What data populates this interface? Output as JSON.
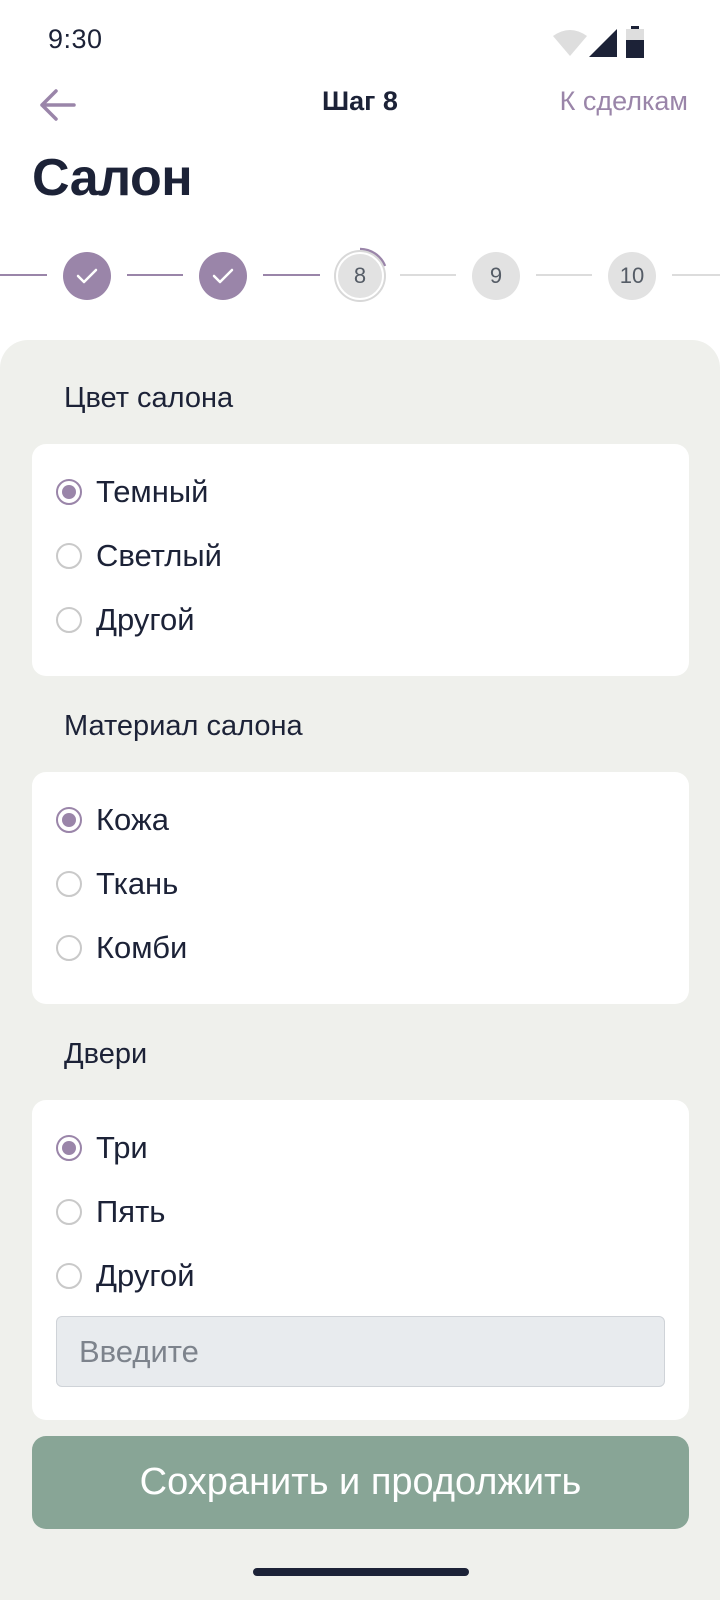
{
  "status_bar": {
    "time": "9:30"
  },
  "header": {
    "step_title": "Шаг 8",
    "to_deals_label": "К сделкам"
  },
  "page_title": "Салон",
  "stepper": {
    "steps": [
      {
        "label": "",
        "state": "done"
      },
      {
        "label": "",
        "state": "done"
      },
      {
        "label": "8",
        "state": "current"
      },
      {
        "label": "9",
        "state": "todo"
      },
      {
        "label": "10",
        "state": "todo"
      }
    ]
  },
  "sections": [
    {
      "title": "Цвет салона",
      "options": [
        {
          "label": "Темный",
          "selected": true
        },
        {
          "label": "Светлый",
          "selected": false
        },
        {
          "label": "Другой",
          "selected": false
        }
      ]
    },
    {
      "title": "Материал салона",
      "options": [
        {
          "label": "Кожа",
          "selected": true
        },
        {
          "label": "Ткань",
          "selected": false
        },
        {
          "label": "Комби",
          "selected": false
        }
      ]
    },
    {
      "title": "Двери",
      "options": [
        {
          "label": "Три",
          "selected": true
        },
        {
          "label": "Пять",
          "selected": false
        },
        {
          "label": "Другой",
          "selected": false
        }
      ],
      "input_placeholder": "Введите",
      "input_value": ""
    }
  ],
  "save_button_label": "Сохранить и продолжить",
  "colors": {
    "accent": "#9a85a9",
    "text": "#1c2237",
    "button": "#88a596",
    "panel": "#eff0ec"
  }
}
